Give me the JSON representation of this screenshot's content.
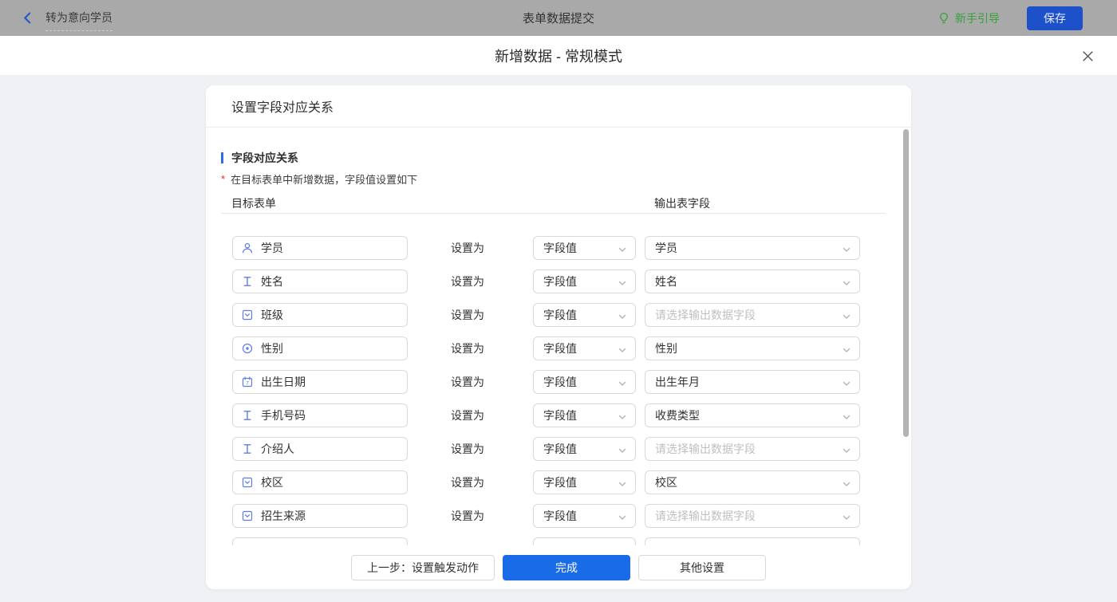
{
  "topbar": {
    "back_label": "转为意向学员",
    "title": "表单数据提交",
    "guide_label": "新手引导",
    "save_label": "保存"
  },
  "modal": {
    "title": "新增数据 - 常规模式"
  },
  "panel": {
    "header": "设置字段对应关系",
    "section_title": "字段对应关系",
    "required_mark": "*",
    "note": "在目标表单中新增数据，字段值设置如下",
    "columns": {
      "left": "目标表单",
      "right": "输出表字段"
    },
    "set_to_label": "设置为",
    "output_placeholder": "请选择输出数据字段"
  },
  "rows": [
    {
      "field": "学员",
      "icon": "user-icon",
      "value_mode": "字段值",
      "output": "学员",
      "output_is_placeholder": false,
      "partial": false
    },
    {
      "field": "姓名",
      "icon": "text-icon",
      "value_mode": "字段值",
      "output": "姓名",
      "output_is_placeholder": false,
      "partial": false
    },
    {
      "field": "班级",
      "icon": "select-icon",
      "value_mode": "字段值",
      "output": "请选择输出数据字段",
      "output_is_placeholder": true,
      "partial": false
    },
    {
      "field": "性别",
      "icon": "radio-icon",
      "value_mode": "字段值",
      "output": "性别",
      "output_is_placeholder": false,
      "partial": false
    },
    {
      "field": "出生日期",
      "icon": "date-icon",
      "value_mode": "字段值",
      "output": "出生年月",
      "output_is_placeholder": false,
      "partial": false
    },
    {
      "field": "手机号码",
      "icon": "text-icon",
      "value_mode": "字段值",
      "output": "收费类型",
      "output_is_placeholder": false,
      "partial": false
    },
    {
      "field": "介绍人",
      "icon": "text-icon",
      "value_mode": "字段值",
      "output": "请选择输出数据字段",
      "output_is_placeholder": true,
      "partial": false
    },
    {
      "field": "校区",
      "icon": "select-icon",
      "value_mode": "字段值",
      "output": "校区",
      "output_is_placeholder": false,
      "partial": false
    },
    {
      "field": "招生来源",
      "icon": "select-icon",
      "value_mode": "字段值",
      "output": "请选择输出数据字段",
      "output_is_placeholder": true,
      "partial": false
    },
    {
      "field": "",
      "icon": "none",
      "value_mode": "",
      "output": "",
      "output_is_placeholder": false,
      "partial": true
    }
  ],
  "footer": {
    "prev_label": "上一步：设置触发动作",
    "done_label": "完成",
    "other_label": "其他设置"
  },
  "colors": {
    "topbar_gray": "#a9a9a9",
    "save_blue": "#1d51c9",
    "done_blue": "#1a6be8",
    "accent_blue": "#2e6be6",
    "icon_blue": "#5f7ce8",
    "guide_green": "#38a13d",
    "required_red": "#f5222d",
    "placeholder_gray": "#bfbfbf"
  }
}
